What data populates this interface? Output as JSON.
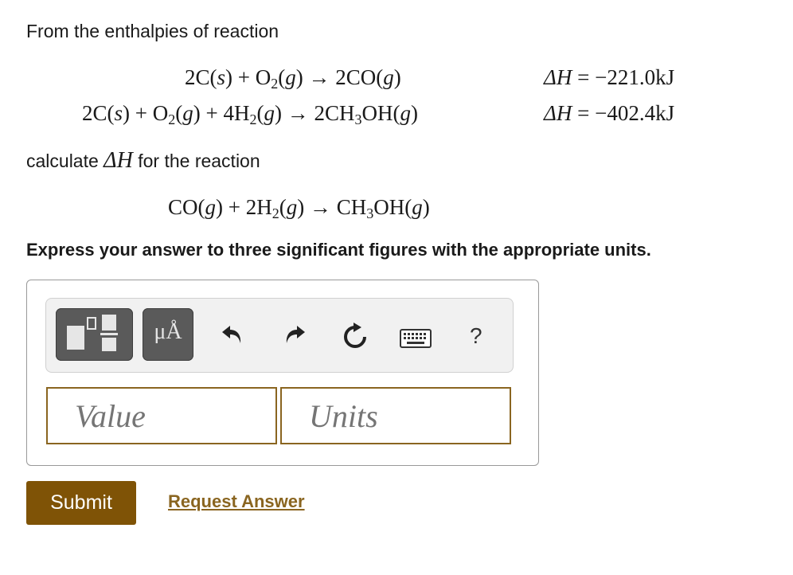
{
  "intro": "From the enthalpies of reaction",
  "reactions": [
    {
      "lhs_parts": [
        "2C(",
        "s",
        ") + O",
        "2",
        "(",
        "g",
        ") → 2CO(",
        "g",
        ")"
      ],
      "dh_label": "ΔH",
      "dh_value": "= −221.0kJ"
    },
    {
      "lhs_parts": [
        "2C(",
        "s",
        ") + O",
        "2",
        "(",
        "g",
        ") + 4H",
        "2",
        "(",
        "g",
        ") → 2CH",
        "3",
        "OH(",
        "g",
        ")"
      ],
      "dh_label": "ΔH",
      "dh_value": "= −402.4kJ"
    }
  ],
  "calculate_prefix": "calculate",
  "calculate_delta": "ΔH",
  "calculate_suffix": "for the reaction",
  "target_reaction": [
    "CO(",
    "g",
    ") + 2H",
    "2",
    "(",
    "g",
    ") → CH",
    "3",
    "OH(",
    "g",
    ")"
  ],
  "instruction": "Express your answer to three significant figures with the appropriate units.",
  "toolbar": {
    "units_label": "μÅ",
    "help_label": "?",
    "icons": [
      "templates-icon",
      "units-icon",
      "undo-icon",
      "redo-icon",
      "reset-icon",
      "keyboard-icon",
      "help-icon"
    ]
  },
  "inputs": {
    "value_placeholder": "Value",
    "units_placeholder": "Units"
  },
  "actions": {
    "submit_label": "Submit",
    "request_label": "Request Answer"
  },
  "colors": {
    "accent": "#7f5306",
    "field_border": "#8a6520",
    "link": "#8a6520",
    "tool_button": "#5a5a5a"
  }
}
